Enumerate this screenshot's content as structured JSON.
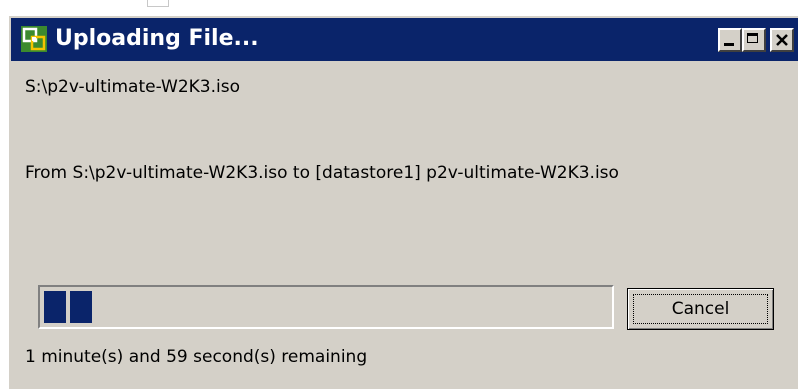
{
  "window": {
    "title": "Uploading File...",
    "app_icon": "vmware-icon",
    "title_bar_color": "#0a246a",
    "face_color": "#d4d0c8"
  },
  "controls": {
    "minimize": "minimize-icon",
    "maximize": "maximize-icon",
    "close": "close-icon"
  },
  "upload": {
    "filename": "S:\\p2v-ultimate-W2K3.iso",
    "from_to": "From S:\\p2v-ultimate-W2K3.iso to [datastore1] p2v-ultimate-W2K3.iso",
    "progress_fraction": 0.08,
    "progress_color": "#0a246a",
    "remaining": "1 minute(s) and 59 second(s) remaining"
  },
  "buttons": {
    "cancel_label": "Cancel"
  }
}
